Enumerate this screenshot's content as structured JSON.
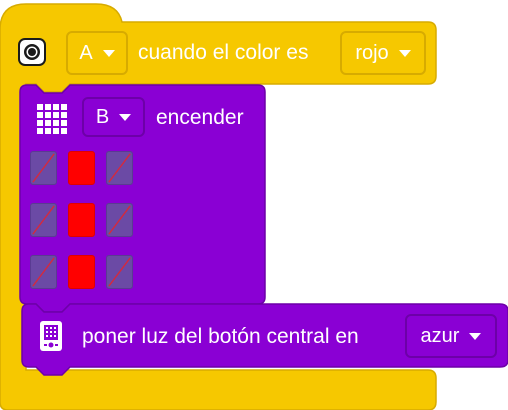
{
  "hat": {
    "port": "A",
    "text": "cuando el color es",
    "color": "rojo"
  },
  "matrix_block": {
    "port": "B",
    "action": "encender",
    "pixels": [
      [
        false,
        true,
        false
      ],
      [
        false,
        true,
        false
      ],
      [
        false,
        true,
        false
      ]
    ]
  },
  "light_block": {
    "text": "poner luz del botón central en",
    "color": "azur"
  },
  "colors": {
    "yellow": "#f6c800",
    "purple": "#8a00d4",
    "pixel_on": "#ff0000",
    "pixel_off": "#6b4aa5"
  },
  "icons": [
    "color-sensor-icon",
    "light-matrix-icon",
    "hub-icon",
    "dropdown-arrow-icon"
  ]
}
